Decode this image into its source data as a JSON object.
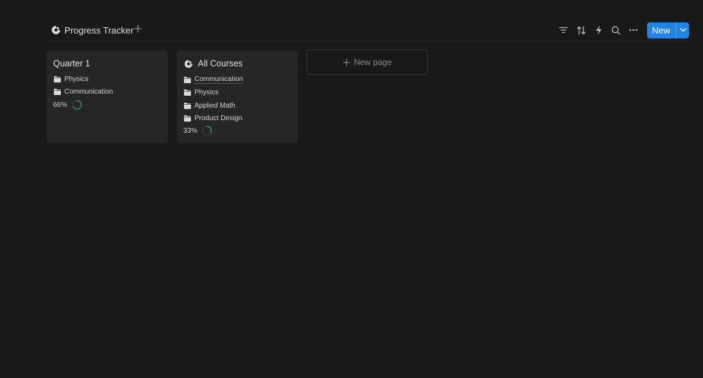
{
  "header": {
    "view_title": "Progress Tracker",
    "view_icon": "pie-chart-icon",
    "new_label": "New",
    "accent": "#2383e2",
    "tools": [
      "filter-icon",
      "sort-icon",
      "automation-icon",
      "search-icon",
      "more-icon"
    ]
  },
  "cards": [
    {
      "title": "Quarter 1",
      "items": [
        {
          "label": "Physics",
          "icon": "folder-icon"
        },
        {
          "label": "Communication",
          "icon": "folder-icon"
        }
      ],
      "progress_label": "66%",
      "progress": 0.66
    },
    {
      "title": "All Courses",
      "title_icon": "pie-chart-icon",
      "items": [
        {
          "label": "Communication",
          "icon": "folder-icon"
        },
        {
          "label": "Physics",
          "icon": "folder-icon"
        },
        {
          "label": "Applied Math",
          "icon": "folder-icon"
        },
        {
          "label": "Product Design",
          "icon": "folder-icon"
        }
      ],
      "progress_label": "33%",
      "progress": 0.33
    }
  ],
  "new_page_label": "New page",
  "progress_color": "#2e7d4f"
}
